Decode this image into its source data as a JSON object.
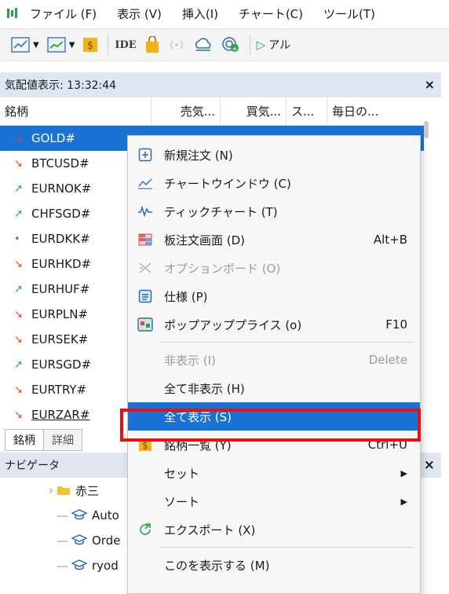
{
  "menubar": {
    "items": [
      "ファイル (F)",
      "表示 (V)",
      "挿入(I)",
      "チャート(C)",
      "ツール(T)"
    ]
  },
  "toolbar": {
    "ide_label": "IDE",
    "algo_label": "アル"
  },
  "market_watch": {
    "title": "気配値表示: 13:32:44",
    "close": "×",
    "columns": [
      "銘柄",
      "売気...",
      "買気...",
      "ス...",
      "毎日の..."
    ],
    "rows": [
      {
        "symbol": "GOLD#",
        "dir": "down",
        "glyph": "↘"
      },
      {
        "symbol": "BTCUSD#",
        "dir": "down",
        "glyph": "↘"
      },
      {
        "symbol": "EURNOK#",
        "dir": "up",
        "glyph": "↗"
      },
      {
        "symbol": "CHFSGD#",
        "dir": "up",
        "glyph": "↗"
      },
      {
        "symbol": "EURDKK#",
        "dir": "flat",
        "glyph": "•"
      },
      {
        "symbol": "EURHKD#",
        "dir": "down",
        "glyph": "↘"
      },
      {
        "symbol": "EURHUF#",
        "dir": "up",
        "glyph": "↗"
      },
      {
        "symbol": "EURPLN#",
        "dir": "down",
        "glyph": "↘"
      },
      {
        "symbol": "EURSEK#",
        "dir": "down",
        "glyph": "↘"
      },
      {
        "symbol": "EURSGD#",
        "dir": "up",
        "glyph": "↗"
      },
      {
        "symbol": "EURTRY#",
        "dir": "down",
        "glyph": "↘"
      },
      {
        "symbol": "EURZAR#",
        "dir": "down",
        "glyph": "↘"
      }
    ],
    "tabs": [
      "銘柄",
      "詳細"
    ]
  },
  "navigator": {
    "title": "ナビゲータ",
    "close": "×",
    "items": [
      "赤三",
      "Auto",
      "Orde",
      "ryod"
    ]
  },
  "context_menu": {
    "items": [
      {
        "label": "新規注文 (N)",
        "shortcut": "",
        "icon": "new-order-icon"
      },
      {
        "label": "チャートウインドウ (C)",
        "shortcut": "",
        "icon": "chart-window-icon"
      },
      {
        "label": "ティックチャート (T)",
        "shortcut": "",
        "icon": "tick-chart-icon"
      },
      {
        "label": "板注文画面 (D)",
        "shortcut": "Alt+B",
        "icon": "depth-of-market-icon"
      },
      {
        "label": "オプションボード (O)",
        "shortcut": "",
        "icon": "option-board-icon"
      },
      {
        "label": "仕様 (P)",
        "shortcut": "",
        "icon": "specification-icon"
      },
      {
        "label": "ポップアッププライス (o)",
        "shortcut": "F10",
        "icon": "popup-prices-icon"
      },
      {
        "label": "非表示 (I)",
        "shortcut": "Delete"
      },
      {
        "label": "全て非表示 (H)",
        "shortcut": ""
      },
      {
        "label": "全て表示 (S)",
        "shortcut": ""
      },
      {
        "label": "銘柄一覧 (Y)",
        "shortcut": "Ctrl+U",
        "icon": "symbols-icon"
      },
      {
        "label": "セット",
        "shortcut": ""
      },
      {
        "label": "ソート",
        "shortcut": ""
      },
      {
        "label": "エクスポート (X)",
        "shortcut": "",
        "icon": "export-icon"
      },
      {
        "label": "このを表示する (M)",
        "shortcut": ""
      }
    ]
  },
  "colors": {
    "selection": "#1a73d4",
    "highlight_frame": "#e51212",
    "panel_title": "#dde6f1",
    "down": "#e0401f",
    "up": "#1b9d4e"
  }
}
